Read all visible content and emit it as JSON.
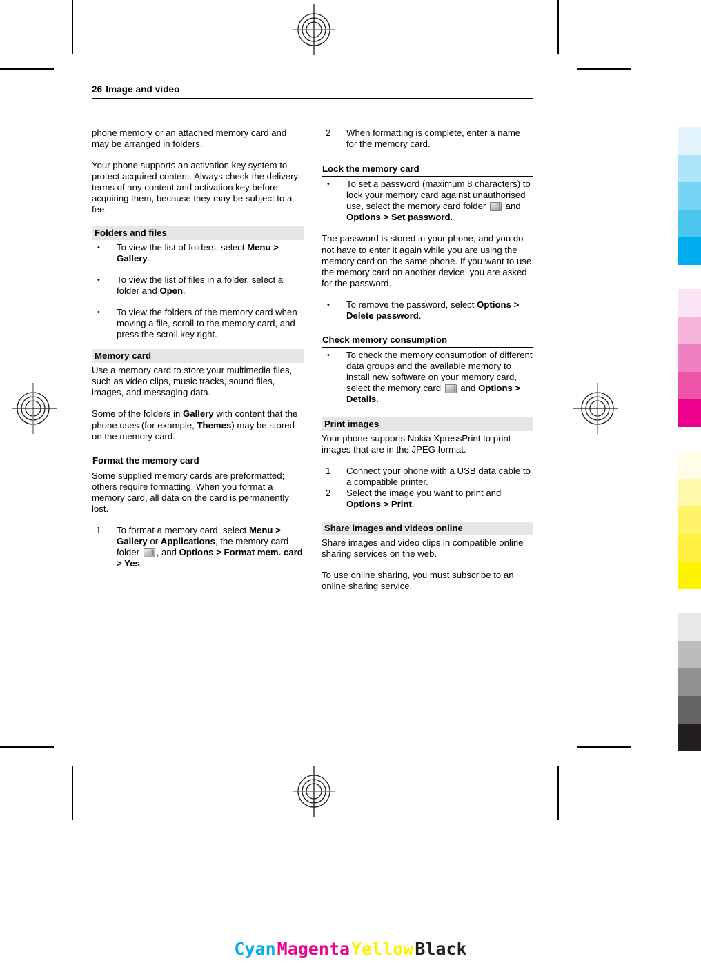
{
  "page": {
    "number": "26",
    "title": "Image and video"
  },
  "left_column": {
    "intro_paragraphs": [
      "phone memory or an attached memory card and may be arranged in folders.",
      "Your phone supports an activation key system to protect acquired content. Always check the delivery terms of any content and activation key before acquiring them, because they may be subject to a fee."
    ],
    "folders_and_files": {
      "heading": "Folders and files",
      "bullets": [
        {
          "marker": "•",
          "before": "To view the list of folders, select ",
          "bold1": "Menu",
          "sep1": " > ",
          "bold2": "Gallery",
          "after": "."
        },
        {
          "marker": "•",
          "before": "To view the list of files in a folder, select a folder and ",
          "bold1": "Open",
          "after": "."
        },
        {
          "marker": "•",
          "text": "To view the folders of the memory card when moving a file, scroll to the memory card, and press the scroll key right."
        }
      ]
    },
    "memory_card": {
      "heading": "Memory card",
      "paragraph1": "Use a memory card to store your multimedia files, such as video clips, music tracks, sound files, images, and messaging data.",
      "paragraph2_part1": "Some of the folders in ",
      "paragraph2_bold1": "Gallery",
      "paragraph2_part2": " with content that the phone uses (for example, ",
      "paragraph2_bold2": "Themes",
      "paragraph2_part3": ") may be stored on the memory card."
    },
    "format_memory_card": {
      "heading": "Format the memory card",
      "paragraph": "Some supplied memory cards are preformatted; others require formatting. When you format a memory card, all data on the card is permanently lost.",
      "step_marker": "1",
      "step_t1": "To format a memory card, select ",
      "step_b1": "Menu",
      "step_t2": " > ",
      "step_b2": "Gallery",
      "step_t3": " or ",
      "step_b3": "Applications",
      "step_t4": ", the memory card folder ",
      "step_icon": "memory-card-folder-icon",
      "step_t5": ", and ",
      "step_b4": "Options",
      "step_t6": " > ",
      "step_b5": "Format mem. card",
      "step_t7": " > ",
      "step_b6": "Yes",
      "step_t8": "."
    }
  },
  "right_column": {
    "format_step2": {
      "marker": "2",
      "text": "When formatting is complete, enter a name for the memory card."
    },
    "lock_the_memory_card": {
      "heading": "Lock the memory card",
      "marker": "•",
      "t1": "To set a password (maximum 8 characters) to lock your memory card against unauthorised use, select the memory card folder ",
      "icon": "memory-card-folder-icon",
      "t2": " and ",
      "b1": "Options",
      "t3": " > ",
      "b2": "Set password",
      "t4": ".",
      "paragraph": "The password is stored in your phone, and you do not have to enter it again while you are using the memory card on the same phone. If you want to use the memory card on another device, you are asked for the password.",
      "remove_marker": "•",
      "remove_t1": "To remove the password, select ",
      "remove_b1": "Options",
      "remove_t2": " > ",
      "remove_b2": "Delete password",
      "remove_t3": "."
    },
    "check_memory_consumption": {
      "heading": "Check memory consumption",
      "marker": "•",
      "t1": "To check the memory consumption of different data groups and the available memory to install new software on your memory card, select the memory card ",
      "icon": "memory-card-folder-icon",
      "t2": " and ",
      "b1": "Options",
      "t3": " > ",
      "b2": "Details",
      "t4": "."
    },
    "print_images": {
      "heading": "Print images",
      "paragraph": "Your phone supports Nokia XpressPrint to print images that are in the JPEG format.",
      "steps": [
        {
          "marker": "1",
          "text": "Connect your phone with a USB data cable to a compatible printer."
        },
        {
          "marker": "2",
          "t1": "Select the image you want to print and ",
          "b1": "Options",
          "t2": " > ",
          "b2": "Print",
          "t3": "."
        }
      ]
    },
    "share_images_and_videos_online": {
      "heading": "Share images and videos online",
      "paragraph1": "Share images and video clips in compatible online sharing services on the web.",
      "paragraph2": "To use online sharing, you must subscribe to an online sharing service."
    }
  },
  "color_strip": {
    "groups": [
      {
        "name": "cyan",
        "swatches": [
          "#e3f4fd",
          "#aee4f8",
          "#77d4f4",
          "#4ac6ef",
          "#00aeef"
        ]
      },
      {
        "name": "magenta",
        "swatches": [
          "#fae4f1",
          "#f7b4da",
          "#f180c0",
          "#ee54a8",
          "#ec008c"
        ]
      },
      {
        "name": "yellow",
        "swatches": [
          "#fffde8",
          "#fff9ab",
          "#fff469",
          "#fff042",
          "#fff200"
        ]
      },
      {
        "name": "black",
        "swatches": [
          "#e8e8e8",
          "#bcbcbc",
          "#919191",
          "#646464",
          "#231f20"
        ]
      }
    ]
  },
  "cmyk_label": {
    "cyan": "Cyan",
    "magenta": "Magenta",
    "yellow": "Yellow",
    "black": "Black",
    "cyan_color": "#00aeef",
    "magenta_color": "#ec008c",
    "yellow_color": "#fff200",
    "black_color": "#231f20"
  }
}
